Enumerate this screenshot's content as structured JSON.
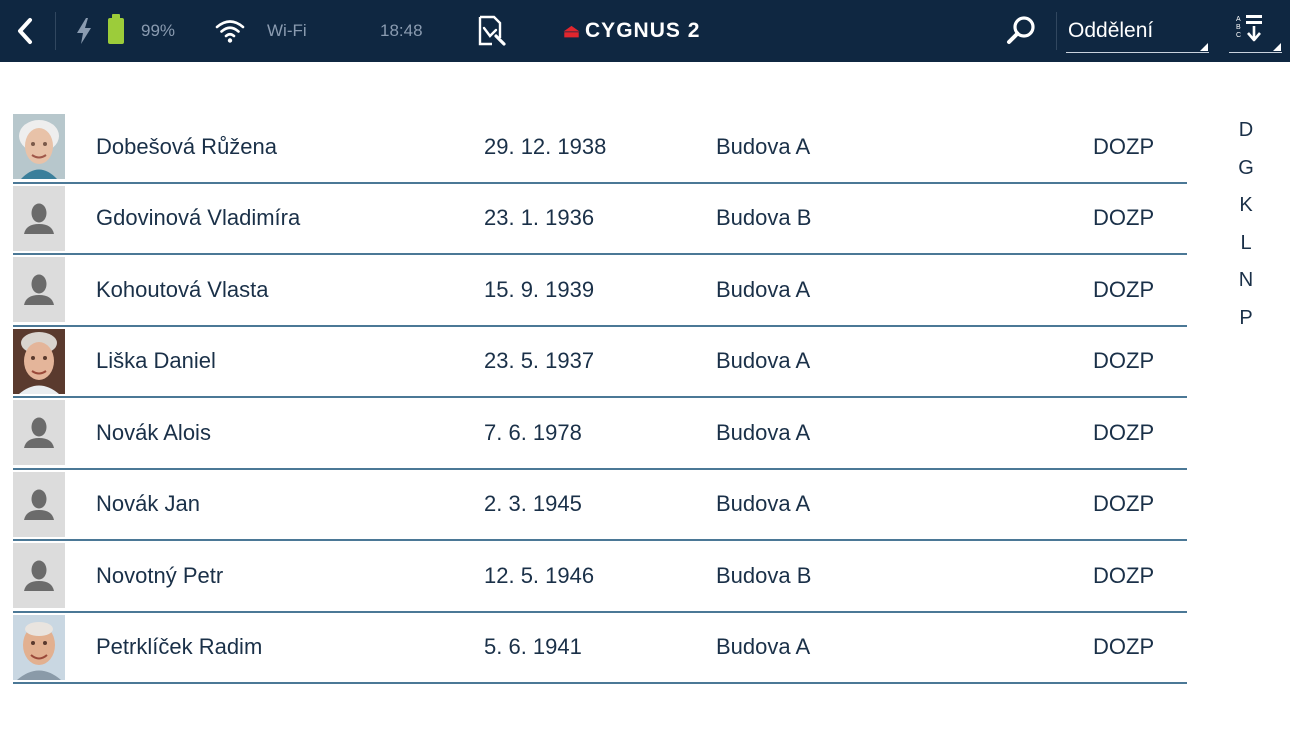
{
  "status": {
    "battery": "99%",
    "wifi_label": "Wi-Fi",
    "time": "18:48"
  },
  "app": {
    "logo_text": "CYGNUS 2"
  },
  "header": {
    "department_label": "Oddělení"
  },
  "colors": {
    "topbar": "#0f2741",
    "text": "#1a3048",
    "row_divider": "#4b7896",
    "battery": "#9ccc3a",
    "logo_mark": "#e0262e"
  },
  "rows": [
    {
      "name": "Dobešová Růžena",
      "date": "29. 12. 1938",
      "building": "Budova A",
      "department": "DOZP",
      "avatar": "photo"
    },
    {
      "name": "Gdovinová Vladimíra",
      "date": "23. 1. 1936",
      "building": "Budova B",
      "department": "DOZP",
      "avatar": "placeholder"
    },
    {
      "name": "Kohoutová Vlasta",
      "date": "15. 9. 1939",
      "building": "Budova A",
      "department": "DOZP",
      "avatar": "placeholder"
    },
    {
      "name": "Liška Daniel",
      "date": "23. 5. 1937",
      "building": "Budova A",
      "department": "DOZP",
      "avatar": "photo"
    },
    {
      "name": "Novák Alois",
      "date": "7. 6. 1978",
      "building": "Budova A",
      "department": "DOZP",
      "avatar": "placeholder"
    },
    {
      "name": "Novák Jan",
      "date": "2. 3. 1945",
      "building": "Budova A",
      "department": "DOZP",
      "avatar": "placeholder"
    },
    {
      "name": "Novotný Petr",
      "date": "12. 5. 1946",
      "building": "Budova B",
      "department": "DOZP",
      "avatar": "placeholder"
    },
    {
      "name": "Petrklíček Radim",
      "date": "5. 6. 1941",
      "building": "Budova A",
      "department": "DOZP",
      "avatar": "photo"
    }
  ],
  "alphabet": [
    "D",
    "G",
    "K",
    "L",
    "N",
    "P"
  ]
}
